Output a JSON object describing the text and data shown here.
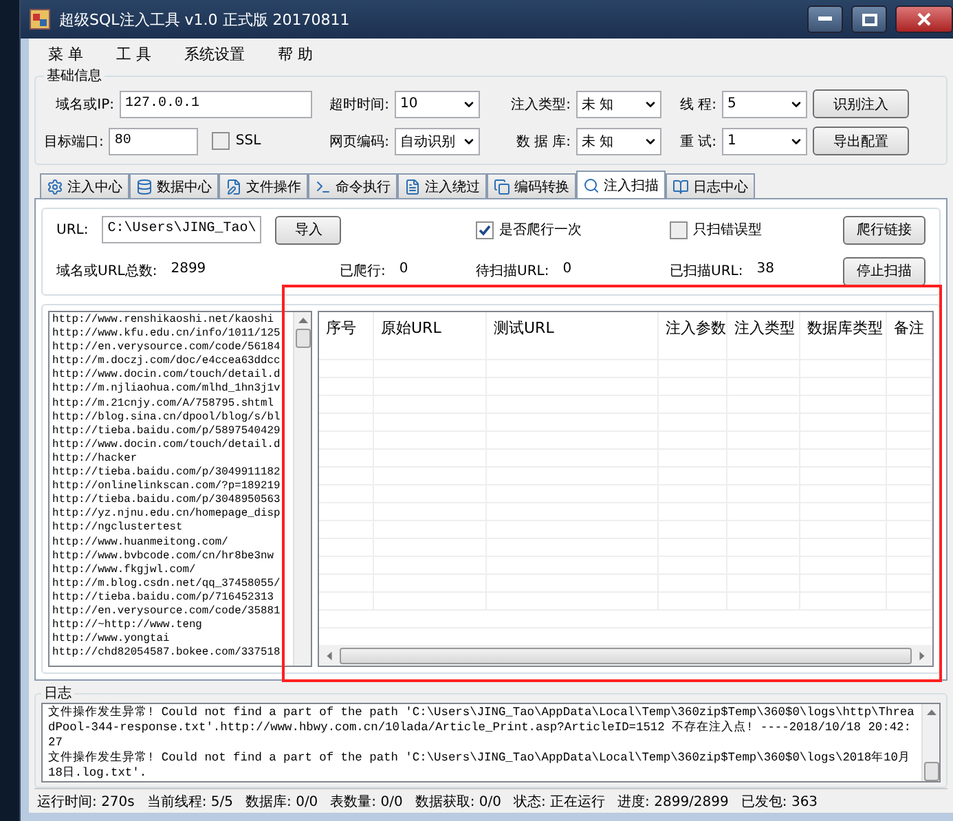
{
  "window": {
    "title": "超级SQL注入工具 v1.0 正式版 20170811"
  },
  "menu": [
    "菜 单",
    "工 具",
    "系统设置",
    "帮 助"
  ],
  "basic_info": {
    "title": "基础信息",
    "rows": [
      [
        [
          {
            "kind": "text",
            "label": "域名或IP:",
            "value": "127.0.0.1"
          }
        ],
        [
          {
            "kind": "select",
            "label": "超时时间:",
            "value": "10"
          }
        ],
        [
          {
            "kind": "select",
            "label": "注入类型:",
            "value": "未 知"
          }
        ],
        [
          {
            "kind": "select",
            "label": "线 程:",
            "value": "5"
          }
        ],
        [
          {
            "kind": "button",
            "label": "识别注入"
          }
        ]
      ],
      [
        [
          {
            "kind": "text",
            "label": "目标端口:",
            "value": "80"
          },
          {
            "kind": "checkbox",
            "label": "SSL",
            "checked": false
          }
        ],
        [
          {
            "kind": "select",
            "label": "网页编码:",
            "value": "自动识别"
          }
        ],
        [
          {
            "kind": "select",
            "label": "数 据 库:",
            "value": "未 知"
          }
        ],
        [
          {
            "kind": "select",
            "label": "重 试:",
            "value": "1"
          }
        ],
        [
          {
            "kind": "button",
            "label": "导出配置"
          }
        ]
      ]
    ]
  },
  "tabs": [
    {
      "label": "注入中心",
      "selected": false
    },
    {
      "label": "数据中心",
      "selected": false
    },
    {
      "label": "文件操作",
      "selected": false
    },
    {
      "label": "命令执行",
      "selected": false
    },
    {
      "label": "注入绕过",
      "selected": false
    },
    {
      "label": "编码转换",
      "selected": false
    },
    {
      "label": "注入扫描",
      "selected": true
    },
    {
      "label": "日志中心",
      "selected": false
    }
  ],
  "scan": {
    "url_label": "URL:",
    "url_value": "C:\\Users\\JING_Tao\\",
    "import_button": "导入",
    "options": [
      {
        "label": "是否爬行一次",
        "checked": true
      },
      {
        "label": "只扫错误型",
        "checked": false
      }
    ],
    "crawl_button": "爬行链接",
    "stop_button": "停止扫描",
    "stats": [
      {
        "label": "域名或URL总数:",
        "value": "2899"
      },
      {
        "label": "已爬行:",
        "value": "0"
      },
      {
        "label": "待扫描URL:",
        "value": "0"
      },
      {
        "label": "已扫描URL:",
        "value": "38"
      }
    ]
  },
  "url_list": [
    "http://www.renshikaoshi.net/kaoshi",
    "http://www.kfu.edu.cn/info/1011/125",
    "http://en.verysource.com/code/56184",
    "http://m.doczj.com/doc/e4ccea63ddcc",
    "http://www.docin.com/touch/detail.d",
    "http://m.njliaohua.com/mlhd_1hn3j1v",
    "http://m.21cnjy.com/A/758795.shtml",
    "http://blog.sina.cn/dpool/blog/s/bl",
    "http://tieba.baidu.com/p/5897540429",
    "http://www.docin.com/touch/detail.d",
    "http://hacker",
    "http://tieba.baidu.com/p/3049911182",
    "http://onlinelinkscan.com/?p=189219",
    "http://tieba.baidu.com/p/3048950563",
    "http://yz.njnu.edu.cn/homepage_disp",
    "http://ngclustertest",
    "http://www.huanmeitong.com/",
    "http://www.bvbcode.com/cn/hr8be3nw",
    "http://www.fkgjwl.com/",
    "http://m.blog.csdn.net/qq_37458055/",
    "http://tieba.baidu.com/p/716452313",
    "http://en.verysource.com/code/35881",
    "http://~http://www.teng",
    "http://www.yongtai",
    "http://chd82054587.bokee.com/337518"
  ],
  "results_table": {
    "columns": [
      "序号",
      "原始URL",
      "测试URL",
      "注入参数",
      "注入类型",
      "数据库类型",
      "备注"
    ]
  },
  "log": {
    "title": "日志",
    "entries": [
      "文件操作发生异常! Could not find a part of the path 'C:\\Users\\JING_Tao\\AppData\\Local\\Temp\\360zip$Temp\\360$0\\logs\\http\\ThreadPool-344-response.txt'.http://www.hbwy.com.cn/10lada/Article_Print.asp?ArticleID=1512 不存在注入点! ----2018/10/18 20:42:27",
      "文件操作发生异常! Could not find a part of the path 'C:\\Users\\JING_Tao\\AppData\\Local\\Temp\\360zip$Temp\\360$0\\logs\\2018年10月18日.log.txt'."
    ]
  },
  "status_bar": [
    {
      "label": "运行时间:",
      "value": "270s"
    },
    {
      "label": "当前线程:",
      "value": "5/5"
    },
    {
      "label": "数据库:",
      "value": "0/0"
    },
    {
      "label": "表数量:",
      "value": "0/0"
    },
    {
      "label": "数据获取:",
      "value": "0/0"
    },
    {
      "label": "状态:",
      "value": "正在运行"
    },
    {
      "label": "进度:",
      "value": "2899/2899"
    },
    {
      "label": "已发包:",
      "value": "363"
    }
  ]
}
